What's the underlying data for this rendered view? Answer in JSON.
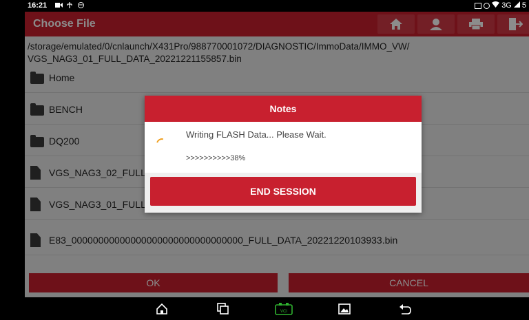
{
  "status_bar": {
    "time": "16:21",
    "network": "3G",
    "carrier": "5"
  },
  "header": {
    "title": "Choose File",
    "buttons": [
      "home-icon",
      "user-icon",
      "print-icon",
      "exit-icon"
    ]
  },
  "path": {
    "text": "/storage/emulated/0/cnlaunch/X431Pro/988770001072/DIAGNOSTIC/ImmoData/IMMO_VW/ VGS_NAG3_01_FULL_DATA_20221221155857.bin"
  },
  "files": [
    {
      "name": "Home",
      "type": "folder"
    },
    {
      "name": "BENCH",
      "type": "folder"
    },
    {
      "name": "DQ200",
      "type": "folder"
    },
    {
      "name": "VGS_NAG3_02_FULL_",
      "type": "file"
    },
    {
      "name": "VGS_NAG3_01_FULL_",
      "type": "file"
    },
    {
      "name": "E83_00000000000000000000000000000000_FULL_DATA_20221220103933.bin",
      "type": "file"
    }
  ],
  "actions": {
    "ok_label": "OK",
    "cancel_label": "CANCEL"
  },
  "dialog": {
    "title": "Notes",
    "message": "Writing FLASH Data... Please Wait.",
    "progress_text": ">>>>>>>>>>38%",
    "progress_percent": 38,
    "end_session_label": "END SESSION"
  },
  "nav_bar": {
    "items": [
      "home-nav-icon",
      "recents-nav-icon",
      "vci-nav-icon",
      "screenshot-nav-icon",
      "back-nav-icon"
    ],
    "vci_label": "VCI",
    "accent": "#2fb12f"
  },
  "colors": {
    "brand_red": "#c8202f",
    "spinner": "#f0a020"
  }
}
